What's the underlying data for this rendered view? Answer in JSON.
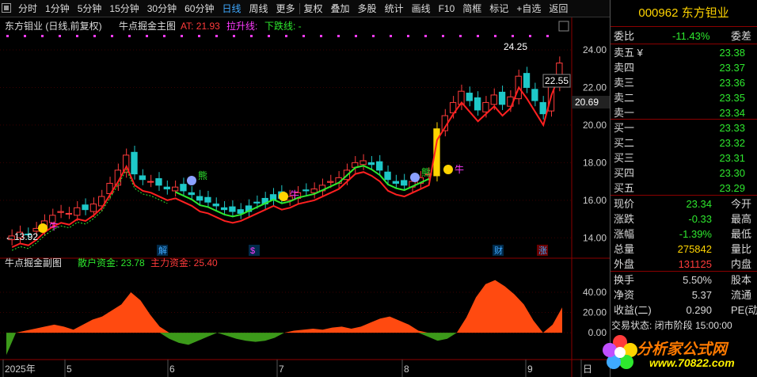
{
  "toolbar": {
    "periods": [
      "分时",
      "1分钟",
      "5分钟",
      "15分钟",
      "30分钟",
      "60分钟",
      "日线",
      "周线",
      "更多"
    ],
    "active_period": "日线",
    "actions": [
      "复权",
      "叠加",
      "多股",
      "统计",
      "画线",
      "F10",
      "简框",
      "标记",
      "+自选",
      "返回"
    ]
  },
  "main_chart": {
    "title": "东方钼业 (日线,前复权)",
    "indicator": "牛点掘金主图",
    "at_label": "AT: 21.93",
    "up_label": "拉升线:",
    "down_label": "下跌线: -",
    "y_ticks": [
      "24.00",
      "22.00",
      "20.00",
      "18.00",
      "16.00",
      "14.00"
    ],
    "high_label": "24.25",
    "high_label2": "22.55",
    "last_price_tag": "20.69",
    "low_label": "13.92",
    "markers": [
      "解",
      "$",
      "财",
      "涨"
    ],
    "tags": [
      "牛",
      "熊",
      "牛",
      "熊",
      "牛"
    ]
  },
  "sub_chart": {
    "indicator": "牛点掘金副图",
    "retail_label": "散户资金: 23.78",
    "main_label": "主力资金: 25.40",
    "y_ticks": [
      "40.00",
      "20.00",
      "0.00"
    ],
    "x_ticks": [
      "2025年",
      "5",
      "6",
      "7",
      "8",
      "9",
      "日"
    ]
  },
  "chart_data": [
    {
      "type": "line",
      "title": "牛点掘金副图",
      "series": [
        {
          "name": "主力资金",
          "values": [
            -22,
            0,
            2,
            4,
            6,
            8,
            6,
            3,
            8,
            13,
            16,
            22,
            28,
            40,
            32,
            18,
            6,
            -6,
            -10,
            -12,
            -8,
            -4,
            0,
            -3,
            -6,
            -8,
            -9,
            -8,
            -5,
            0,
            2,
            3,
            4,
            3,
            5,
            6,
            4,
            6,
            10,
            14,
            16,
            12,
            8,
            2,
            -4,
            -8,
            -6,
            0,
            15,
            35,
            48,
            52,
            46,
            38,
            28,
            12,
            0,
            8,
            25
          ]
        }
      ]
    }
  ],
  "quote": {
    "code_name": "000962 东方钽业",
    "weibi_label": "委比",
    "weibi": "-11.43%",
    "weicha_label": "委差",
    "asks": [
      {
        "label": "卖五 ¥",
        "price": "23.38"
      },
      {
        "label": "卖四",
        "price": "23.37"
      },
      {
        "label": "卖三",
        "price": "23.36"
      },
      {
        "label": "卖二",
        "price": "23.35"
      },
      {
        "label": "卖一",
        "price": "23.34"
      }
    ],
    "bids": [
      {
        "label": "买一",
        "price": "23.33"
      },
      {
        "label": "买二",
        "price": "23.32"
      },
      {
        "label": "买三",
        "price": "23.31"
      },
      {
        "label": "买四",
        "price": "23.30"
      },
      {
        "label": "买五",
        "price": "23.29"
      }
    ],
    "stats": [
      {
        "l1": "现价",
        "v1": "23.34",
        "c1": "g",
        "l2": "今开"
      },
      {
        "l1": "涨跌",
        "v1": "-0.33",
        "c1": "g",
        "l2": "最高"
      },
      {
        "l1": "涨幅",
        "v1": "-1.39%",
        "c1": "g",
        "l2": "最低"
      },
      {
        "l1": "总量",
        "v1": "275842",
        "c1": "y",
        "l2": "量比"
      },
      {
        "l1": "外盘",
        "v1": "131125",
        "c1": "r",
        "l2": "内盘"
      }
    ],
    "stats2": [
      {
        "l1": "换手",
        "v1": "5.50%",
        "l2": "股本"
      },
      {
        "l1": "净资",
        "v1": "5.37",
        "l2": "流通"
      },
      {
        "l1": "收益(二)",
        "v1": "0.290",
        "l2": "PE(动)"
      }
    ],
    "status": "交易状态: 闭市阶段 15:00:00"
  },
  "logo": {
    "line1": "分析家公式网",
    "line2": "www.70822.com"
  }
}
